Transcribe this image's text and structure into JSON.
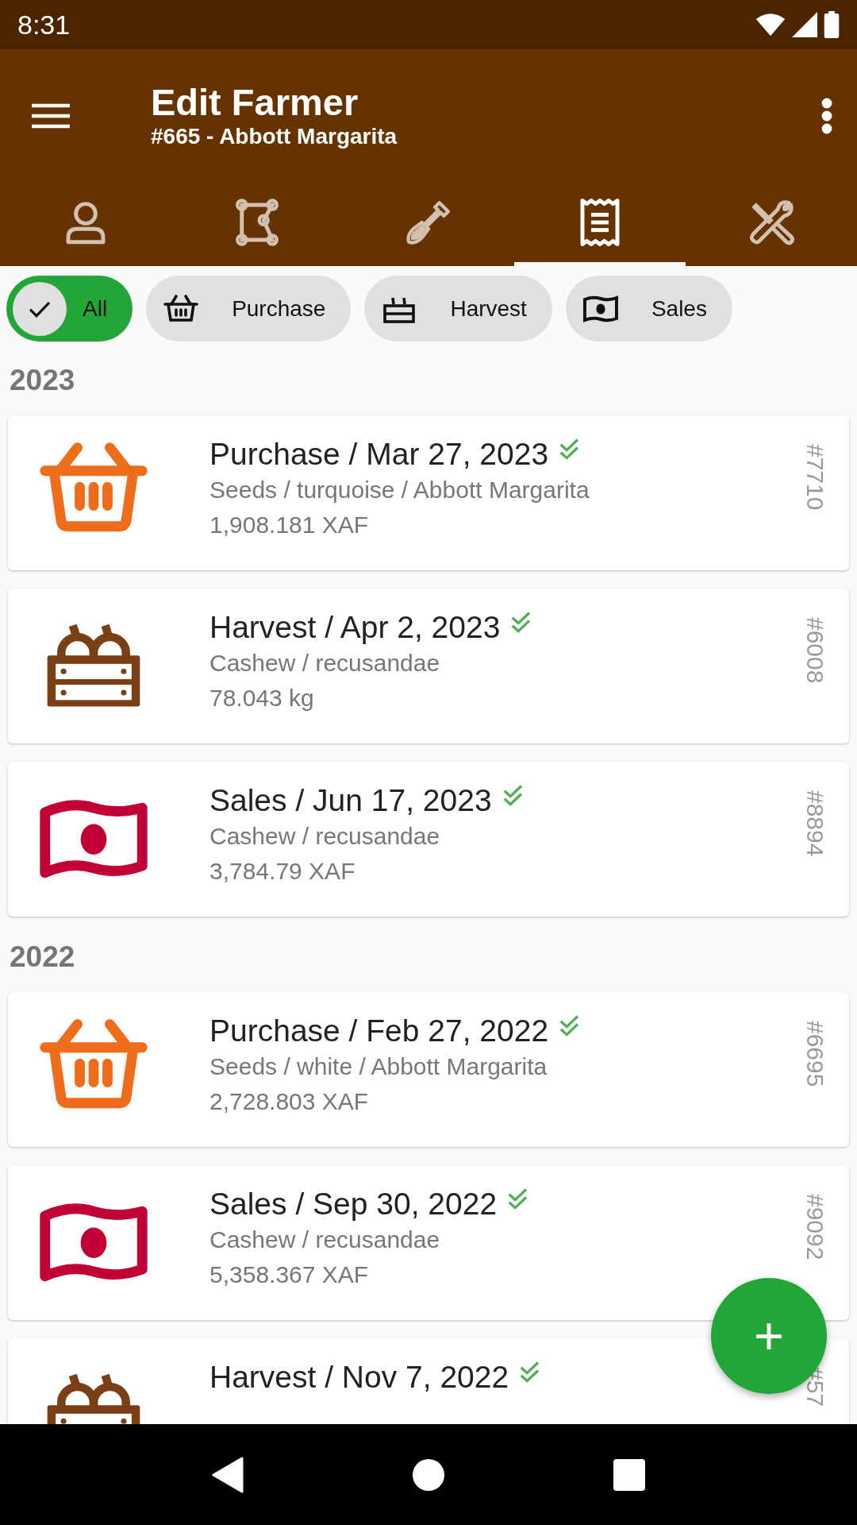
{
  "status_bar": {
    "time": "8:31"
  },
  "app_bar": {
    "title": "Edit Farmer",
    "subtitle": "#665 - Abbott Margarita"
  },
  "tabs": [
    {
      "selected": false
    },
    {
      "selected": false
    },
    {
      "selected": false
    },
    {
      "selected": true
    },
    {
      "selected": false
    }
  ],
  "filters": [
    {
      "label": "All",
      "selected": true
    },
    {
      "kind": "purchase",
      "label": "Purchase",
      "selected": false
    },
    {
      "kind": "harvest",
      "label": "Harvest",
      "selected": false
    },
    {
      "kind": "sales",
      "label": "Sales",
      "selected": false
    }
  ],
  "groups": [
    {
      "year": "2023",
      "records": [
        {
          "kind": "purchase",
          "title": "Purchase / Mar 27, 2023",
          "verified": true,
          "subtitle": "Seeds / turquoise / Abbott Margarita",
          "amount": "1,908.181 XAF",
          "id": "#7710"
        },
        {
          "kind": "harvest",
          "title": "Harvest / Apr 2, 2023",
          "verified": true,
          "subtitle": "Cashew / recusandae",
          "amount": "78.043 kg",
          "id": "#6008"
        },
        {
          "kind": "sales",
          "title": "Sales / Jun 17, 2023",
          "verified": true,
          "subtitle": "Cashew / recusandae",
          "amount": "3,784.79 XAF",
          "id": "#8894"
        }
      ]
    },
    {
      "year": "2022",
      "records": [
        {
          "kind": "purchase",
          "title": "Purchase / Feb 27, 2022",
          "verified": true,
          "subtitle": "Seeds / white / Abbott Margarita",
          "amount": "2,728.803 XAF",
          "id": "#6695"
        },
        {
          "kind": "sales",
          "title": "Sales / Sep 30, 2022",
          "verified": true,
          "subtitle": "Cashew / recusandae",
          "amount": "5,358.367 XAF",
          "id": "#9092"
        },
        {
          "kind": "harvest",
          "title": "Harvest / Nov 7, 2022",
          "verified": true,
          "id": "#57"
        }
      ]
    }
  ],
  "fab": {
    "label": "+"
  }
}
